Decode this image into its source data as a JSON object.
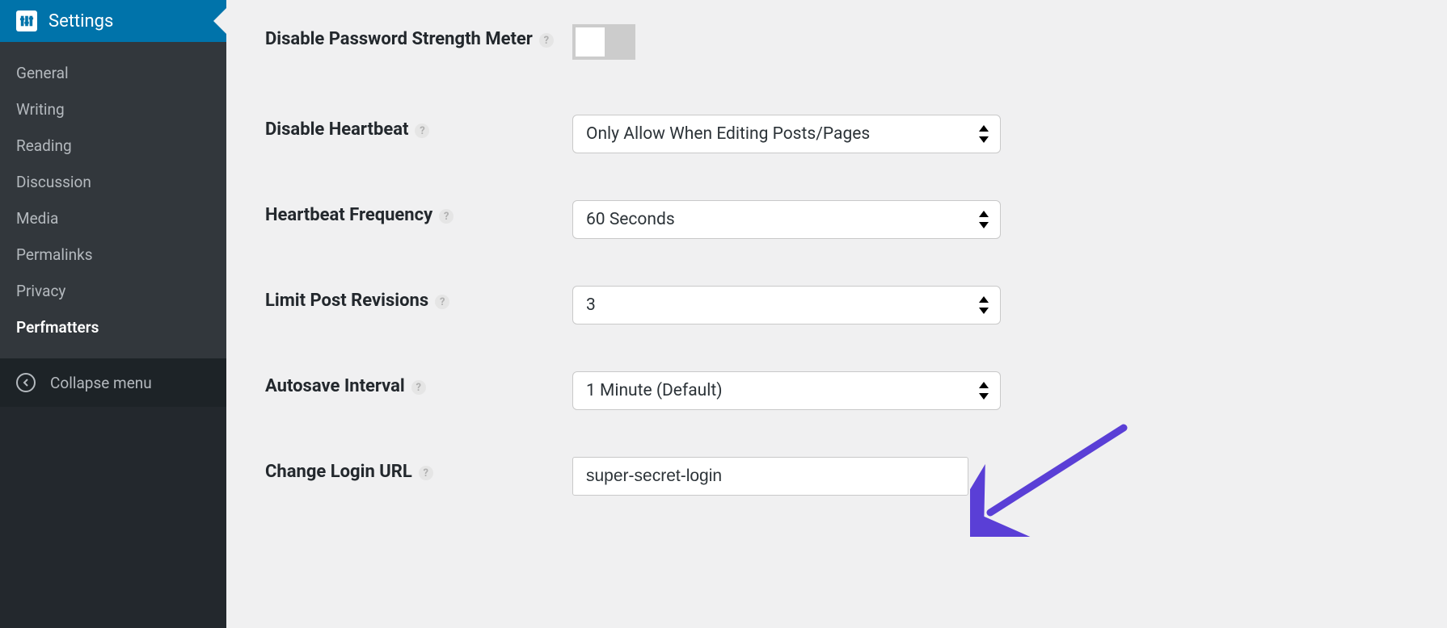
{
  "sidebar": {
    "header_label": "Settings",
    "items": [
      {
        "label": "General"
      },
      {
        "label": "Writing"
      },
      {
        "label": "Reading"
      },
      {
        "label": "Discussion"
      },
      {
        "label": "Media"
      },
      {
        "label": "Permalinks"
      },
      {
        "label": "Privacy"
      },
      {
        "label": "Perfmatters"
      }
    ],
    "collapse_label": "Collapse menu"
  },
  "form": {
    "disable_password_meter": {
      "label": "Disable Password Strength Meter"
    },
    "disable_heartbeat": {
      "label": "Disable Heartbeat",
      "value": "Only Allow When Editing Posts/Pages"
    },
    "heartbeat_frequency": {
      "label": "Heartbeat Frequency",
      "value": "60 Seconds"
    },
    "limit_post_revisions": {
      "label": "Limit Post Revisions",
      "value": "3"
    },
    "autosave_interval": {
      "label": "Autosave Interval",
      "value": "1 Minute (Default)"
    },
    "change_login_url": {
      "label": "Change Login URL",
      "value": "super-secret-login"
    }
  }
}
